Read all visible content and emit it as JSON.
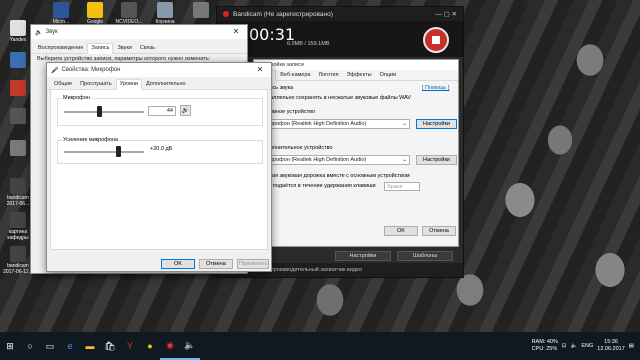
{
  "desktop": {
    "icons": [
      {
        "label": "Yandex",
        "color": "#e0e0e0"
      },
      {
        "label": "",
        "color": "#3a6fb0"
      },
      {
        "label": "",
        "color": "#c0392b"
      },
      {
        "label": "",
        "color": "#555"
      },
      {
        "label": "",
        "color": "#7a7a7a"
      },
      {
        "label": "bandicam 2017-06...",
        "color": "#444"
      },
      {
        "label": "картина кафедры",
        "color": "#444"
      },
      {
        "label": "bandicam 2017-06-12...",
        "color": "#444"
      }
    ],
    "top_icons": [
      {
        "label": "Micro...",
        "color": "#2b5797"
      },
      {
        "label": "Google Chrome",
        "color": "#f4c20d"
      },
      {
        "label": "NCVIDEO...",
        "color": "#555"
      },
      {
        "label": "Корзина",
        "color": "#8899aa"
      },
      {
        "label": "",
        "color": "#777"
      }
    ]
  },
  "sound_window": {
    "title": "Звук",
    "tabs": [
      "Воспроизведение",
      "Запись",
      "Звуки",
      "Связь"
    ],
    "active_tab": 1,
    "hint": "Выберите устройство записи, параметры которого нужно изменить:"
  },
  "mic_props": {
    "title": "Свойства: Микрофон",
    "tabs": [
      "Общие",
      "Прослушать",
      "Уровни",
      "Дополнительно"
    ],
    "active_tab": 2,
    "mic_label": "Микрофон",
    "mic_value": "44",
    "mic_level": 0.44,
    "boost_label": "Усиление микрофона",
    "boost_value": "+20.0 дБ",
    "boost_level": 0.67,
    "ok": "OK",
    "cancel": "Отмена",
    "apply": "Применить"
  },
  "bandicam": {
    "title": "Bandicam (Не зарегистрировано)",
    "timer": "00:31",
    "size": "6.0MB / 159.1MB",
    "panel_title": "Настройки записи",
    "tabs": [
      "Звук",
      "Веб-камера",
      "Логотип",
      "Эффекты",
      "Опции"
    ],
    "sound_group": "Запись звука",
    "wav_text": "Параллельно сохранять в несжатые звуковые файлы WAV",
    "help_link": "[ Помощь ]",
    "main_device_label": "Основное устройство",
    "main_device_value": "Микрофон (Realtek High Definition Audio)",
    "settings_btn": "Настройки",
    "extra_device_label": "Дополнительное устройство",
    "extra_device_value": "Микрофон (Realtek High Definition Audio)",
    "settings_btn2": "Настройки",
    "mix_text": "Общая звуковая дорожка вместе с основным устройством",
    "hold_text": "Звук подаётся в течение удержания клавиши",
    "hold_key": "Space",
    "ok": "OK",
    "cancel": "Отмена",
    "settings_footer": "Настройки",
    "templates_footer": "Шаблоны",
    "status": "Bandicam - высокопроизводительный захватчик видео"
  },
  "taskbar": {
    "lang": "ENG",
    "time": "15:36",
    "date": "12.06.2017",
    "ram": "RAM: 40%",
    "cpu": "CPU: 25%"
  }
}
